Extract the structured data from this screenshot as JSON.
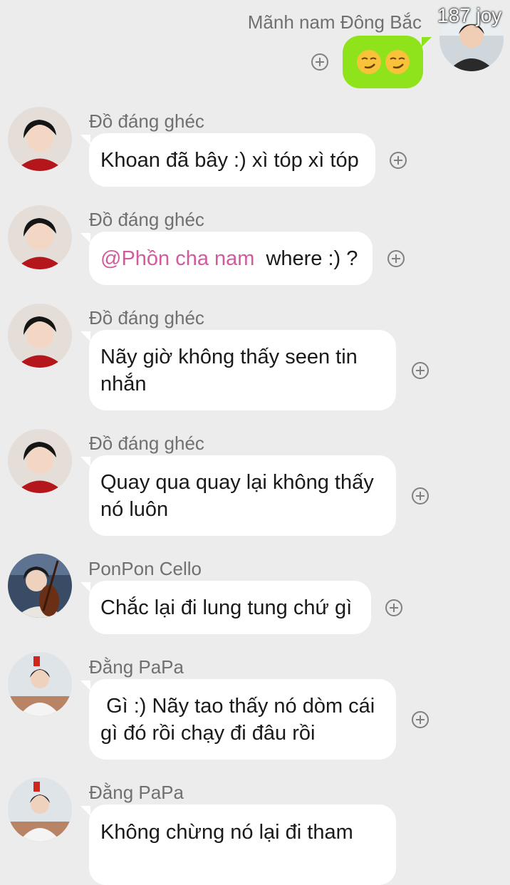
{
  "self": {
    "name": "Mãnh nam Đông Bắc",
    "tag": "187 joy",
    "message": "😏😏"
  },
  "messages": [
    {
      "sender": "Đồ đáng ghéc",
      "text": "Khoan đã bây :) xì tóp xì tóp"
    },
    {
      "sender": "Đồ đáng ghéc",
      "mention": "@Phồn cha nam",
      "text": "where :) ?"
    },
    {
      "sender": "Đồ đáng ghéc",
      "text": "Nãy giờ không thấy seen tin nhắn"
    },
    {
      "sender": "Đồ đáng ghéc",
      "text": "Quay qua quay lại không thấy nó luôn"
    },
    {
      "sender": "PonPon Cello",
      "text": "Chắc lại đi lung tung chứ gì"
    },
    {
      "sender": "Đằng PaPa",
      "text": " Gì :) Nãy tao thấy nó dòm cái gì đó rồi chạy đi đâu rồi"
    },
    {
      "sender": "Đằng PaPa",
      "text": "Không chừng nó lại đi tham"
    }
  ],
  "colors": {
    "background": "#ececec",
    "bubble": "#ffffff",
    "self_bubble": "#8fe31a",
    "mention": "#d35b9c"
  },
  "icons": {
    "add_reaction": "plus-circle-icon",
    "avatar": "avatar-photo"
  }
}
